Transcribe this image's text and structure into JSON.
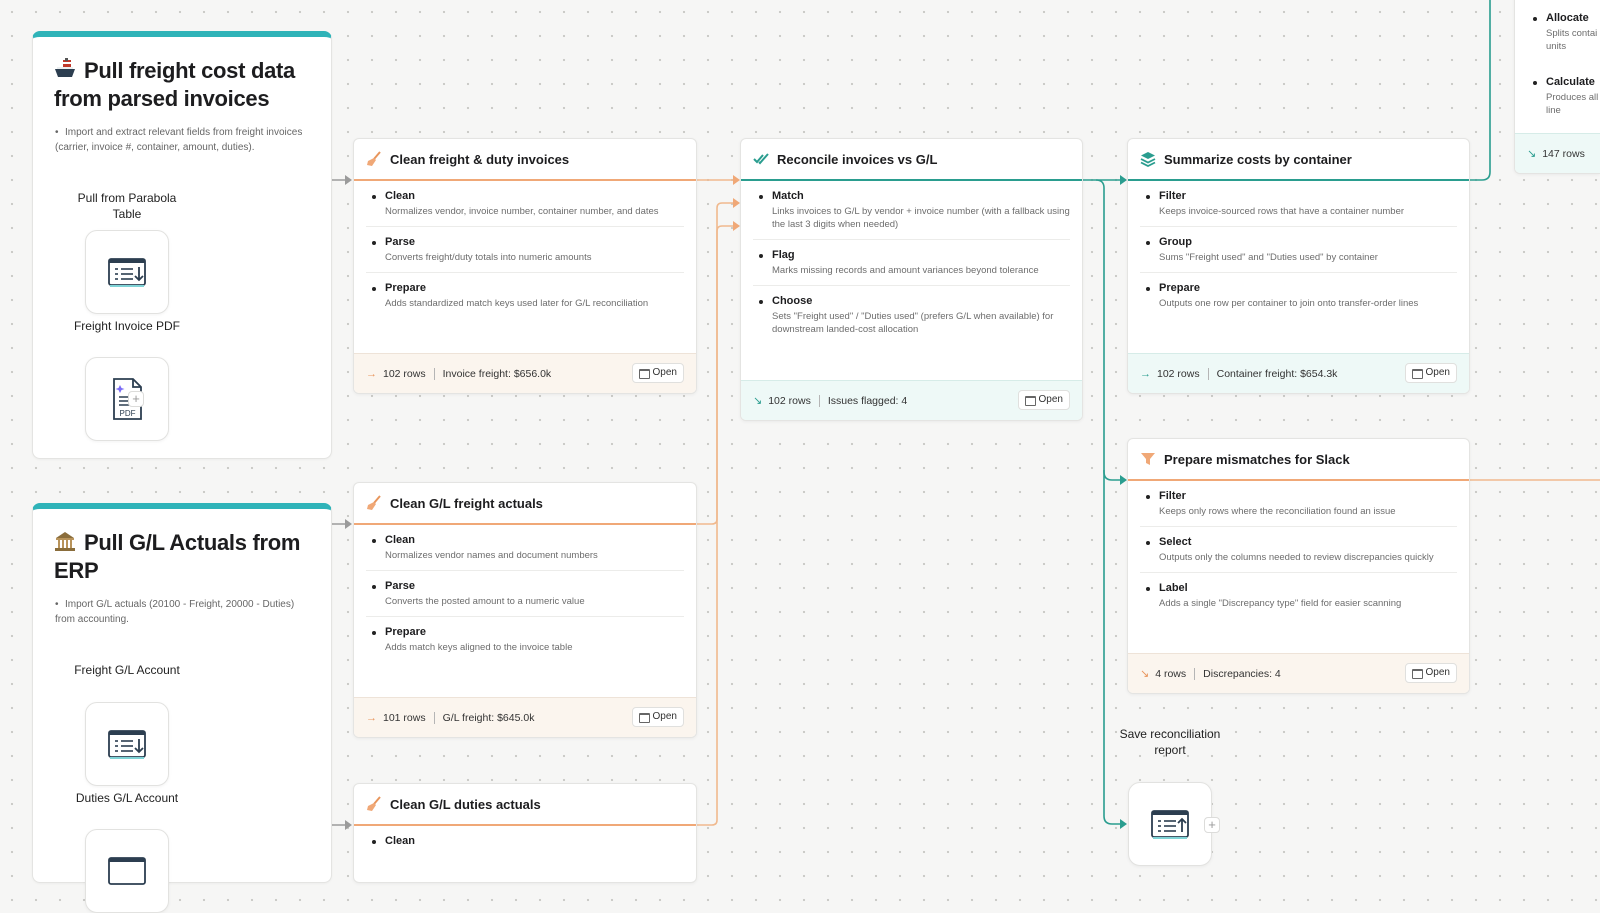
{
  "sources": [
    {
      "title": "Pull freight cost data from parsed invoices",
      "desc": "Import and extract relevant fields from freight invoices (carrier, invoice #, container, amount, duties).",
      "label1": "Pull from Parabola Table",
      "label2": "Freight Invoice PDF",
      "pdf_text": "PDF"
    },
    {
      "title": "Pull G/L Actuals from ERP",
      "desc": "Import G/L actuals (20100 - Freight, 20000 - Duties) from accounting.",
      "label1": "Freight G/L Account",
      "label2": "Duties G/L Account"
    }
  ],
  "steps": {
    "clean_invoices": {
      "title": "Clean freight & duty invoices",
      "items": [
        {
          "title": "Clean",
          "desc": "Normalizes vendor, invoice number, container number, and dates"
        },
        {
          "title": "Parse",
          "desc": "Converts freight/duty totals into numeric amounts"
        },
        {
          "title": "Prepare",
          "desc": "Adds standardized match keys used later for G/L reconciliation"
        }
      ],
      "rows": "102 rows",
      "metric": "Invoice freight: $656.0k",
      "open": "Open"
    },
    "reconcile": {
      "title": "Reconcile invoices vs G/L",
      "items": [
        {
          "title": "Match",
          "desc": "Links invoices to G/L by vendor + invoice number (with a fallback using the last 3 digits when needed)"
        },
        {
          "title": "Flag",
          "desc": "Marks missing records and amount variances beyond tolerance"
        },
        {
          "title": "Choose",
          "desc": "Sets \"Freight used\" / \"Duties used\" (prefers G/L when available) for downstream landed-cost allocation"
        }
      ],
      "rows": "102 rows",
      "metric": "Issues flagged: 4",
      "open": "Open"
    },
    "summarize": {
      "title": "Summarize costs by container",
      "items": [
        {
          "title": "Filter",
          "desc": "Keeps invoice-sourced rows that have a container number"
        },
        {
          "title": "Group",
          "desc": "Sums \"Freight used\" and \"Duties used\" by container"
        },
        {
          "title": "Prepare",
          "desc": "Outputs one row per container to join onto transfer-order lines"
        }
      ],
      "rows": "102 rows",
      "metric": "Container freight: $654.3k",
      "open": "Open"
    },
    "allocate": {
      "items": [
        {
          "title": "Allocate",
          "desc": "Splits contai units"
        },
        {
          "title": "Calculate",
          "desc": "Produces all line"
        }
      ],
      "rows": "147 rows"
    },
    "mismatches": {
      "title": "Prepare mismatches for Slack",
      "items": [
        {
          "title": "Filter",
          "desc": "Keeps only rows where the reconciliation found an issue"
        },
        {
          "title": "Select",
          "desc": "Outputs only the columns needed to review discrepancies quickly"
        },
        {
          "title": "Label",
          "desc": "Adds a single \"Discrepancy type\" field for easier scanning"
        }
      ],
      "rows": "4 rows",
      "metric": "Discrepancies: 4",
      "open": "Open"
    },
    "clean_gl_freight": {
      "title": "Clean G/L freight actuals",
      "items": [
        {
          "title": "Clean",
          "desc": "Normalizes vendor names and document numbers"
        },
        {
          "title": "Parse",
          "desc": "Converts the posted amount to a numeric value"
        },
        {
          "title": "Prepare",
          "desc": "Adds match keys aligned to the invoice table"
        }
      ],
      "rows": "101 rows",
      "metric": "G/L freight: $645.0k",
      "open": "Open"
    },
    "clean_gl_duties": {
      "title": "Clean G/L duties actuals",
      "items": [
        {
          "title": "Clean",
          "desc": ""
        }
      ]
    }
  },
  "export": {
    "label": "Save reconciliation report"
  },
  "colors": {
    "accent_teal": "#2a9d8f",
    "accent_orange": "#f0a877",
    "wire_gray": "#9b9b9b"
  },
  "icons": [
    "ship-icon",
    "bank-icon",
    "broom-icon",
    "double-check-icon",
    "stack-icon",
    "funnel-icon",
    "table-import-icon",
    "pdf-file-icon",
    "table-export-icon",
    "plus-icon",
    "open-window-icon"
  ]
}
